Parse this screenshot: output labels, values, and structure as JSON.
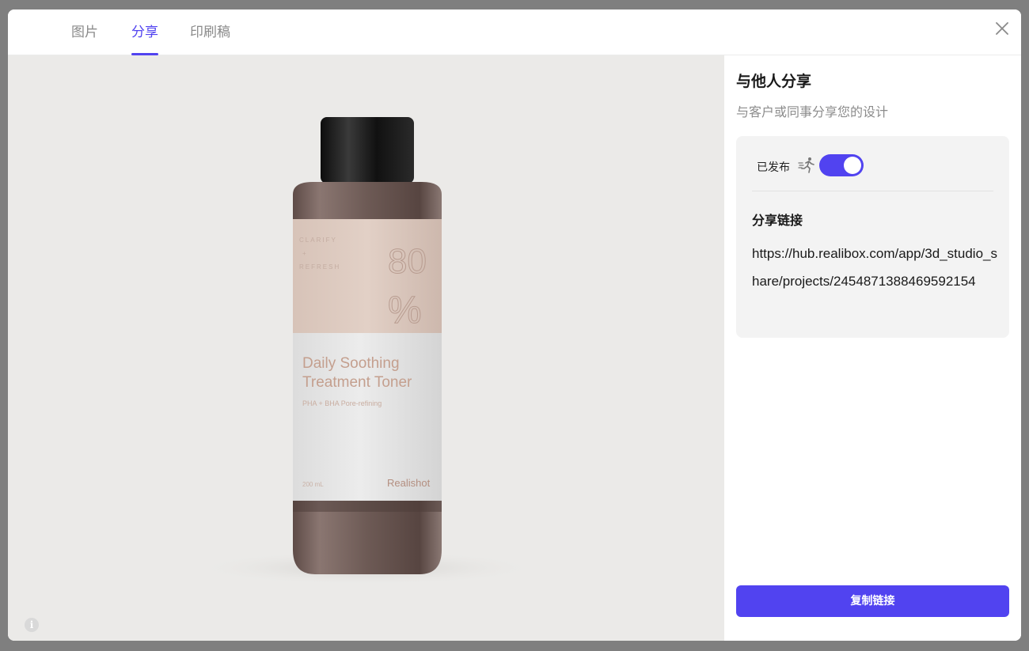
{
  "tabs": [
    {
      "label": "图片",
      "active": false
    },
    {
      "label": "分享",
      "active": true
    },
    {
      "label": "印刷稿",
      "active": false
    }
  ],
  "colors": {
    "accent": "#5143f0",
    "preview_bg": "#ebeae8",
    "card_bg": "#f3f3f3"
  },
  "preview": {
    "product": {
      "label_percent": "80",
      "label_percent_sign": "%",
      "label_small_1": "CLARIFY",
      "label_small_2": "+",
      "label_small_3": "REFRESH",
      "name_line1": "Daily Soothing",
      "name_line2": "Treatment Toner",
      "subtitle": "PHA + BHA Pore-refining",
      "volume": "200 mL",
      "brand": "Realishot"
    },
    "info_icon": "info-icon"
  },
  "share": {
    "title": "与他人分享",
    "subtitle": "与客户或同事分享您的设计",
    "published_label": "已发布",
    "published": true,
    "link_label": "分享链接",
    "link_url": "https://hub.realibox.com/app/3d_studio_share/projects/2454871388469592154",
    "copy_button": "复制链接"
  }
}
